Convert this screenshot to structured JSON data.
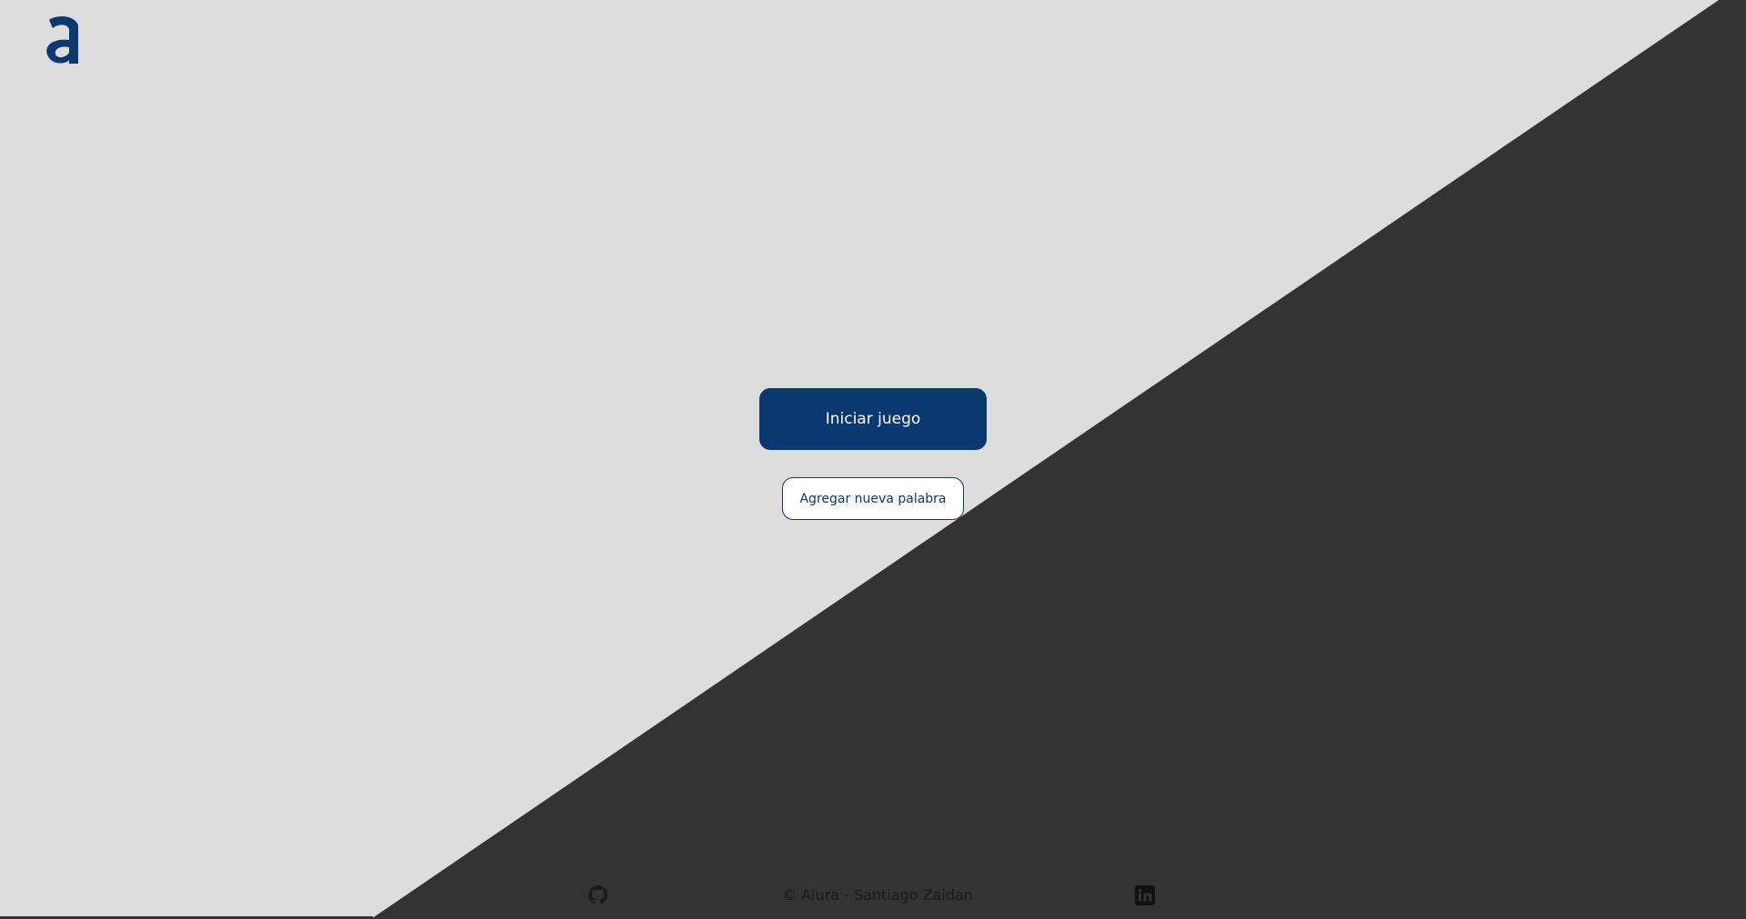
{
  "colors": {
    "background_light": "#dddddd",
    "background_dark": "#333333",
    "brand": "#0a3871",
    "button_text_light": "#ffffff"
  },
  "logo": {
    "icon": "alura-logo-icon",
    "glyph": "a"
  },
  "actions": {
    "start_label": "Iniciar juego",
    "add_word_label": "Agregar nueva palabra"
  },
  "footer": {
    "copyright": "© Alura - Santiago Zaidan",
    "github_icon": "github-icon",
    "linkedin_icon": "linkedin-icon"
  }
}
